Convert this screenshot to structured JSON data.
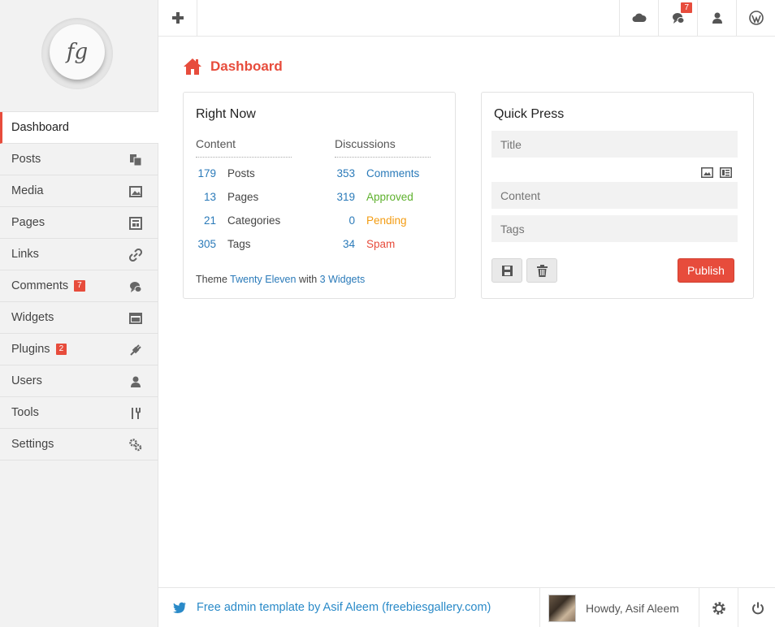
{
  "sidebar": {
    "logo_text": "fg",
    "items": [
      {
        "label": "Dashboard",
        "icon": "dashboard",
        "badge": ""
      },
      {
        "label": "Posts",
        "icon": "posts-icon",
        "badge": ""
      },
      {
        "label": "Media",
        "icon": "image-icon",
        "badge": ""
      },
      {
        "label": "Pages",
        "icon": "pages-icon",
        "badge": ""
      },
      {
        "label": "Links",
        "icon": "link-icon",
        "badge": ""
      },
      {
        "label": "Comments",
        "icon": "comments-icon",
        "badge": "7"
      },
      {
        "label": "Widgets",
        "icon": "widgets-icon",
        "badge": ""
      },
      {
        "label": "Plugins",
        "icon": "plug-icon",
        "badge": "2"
      },
      {
        "label": "Users",
        "icon": "user-icon",
        "badge": ""
      },
      {
        "label": "Tools",
        "icon": "tools-icon",
        "badge": ""
      },
      {
        "label": "Settings",
        "icon": "gears-icon",
        "badge": ""
      }
    ]
  },
  "topbar": {
    "comments_badge": "7"
  },
  "page": {
    "title": "Dashboard"
  },
  "right_now": {
    "title": "Right Now",
    "content_heading": "Content",
    "discussions_heading": "Discussions",
    "content": [
      {
        "num": "179",
        "label": "Posts"
      },
      {
        "num": "13",
        "label": "Pages"
      },
      {
        "num": "21",
        "label": "Categories"
      },
      {
        "num": "305",
        "label": "Tags"
      }
    ],
    "discussions": [
      {
        "num": "353",
        "label": "Comments",
        "color": "#2a7ab9"
      },
      {
        "num": "319",
        "label": "Approved",
        "color": "#5fb12e"
      },
      {
        "num": "0",
        "label": "Pending",
        "color": "#f39c12"
      },
      {
        "num": "34",
        "label": "Spam",
        "color": "#e74c3c"
      }
    ],
    "theme_prefix": "Theme",
    "theme_name": "Twenty Eleven",
    "theme_with": "with",
    "widgets_link": "3 Widgets"
  },
  "quick_press": {
    "title": "Quick Press",
    "title_placeholder": "Title",
    "content_placeholder": "Content",
    "tags_placeholder": "Tags",
    "publish_label": "Publish"
  },
  "footer": {
    "credit": "Free admin template by Asif Aleem (freebiesgallery.com)",
    "greeting": "Howdy, Asif Aleem"
  },
  "colors": {
    "accent": "#e74c3c",
    "link": "#2a7ab9",
    "approved": "#5fb12e",
    "pending": "#f39c12",
    "spam": "#e74c3c"
  }
}
